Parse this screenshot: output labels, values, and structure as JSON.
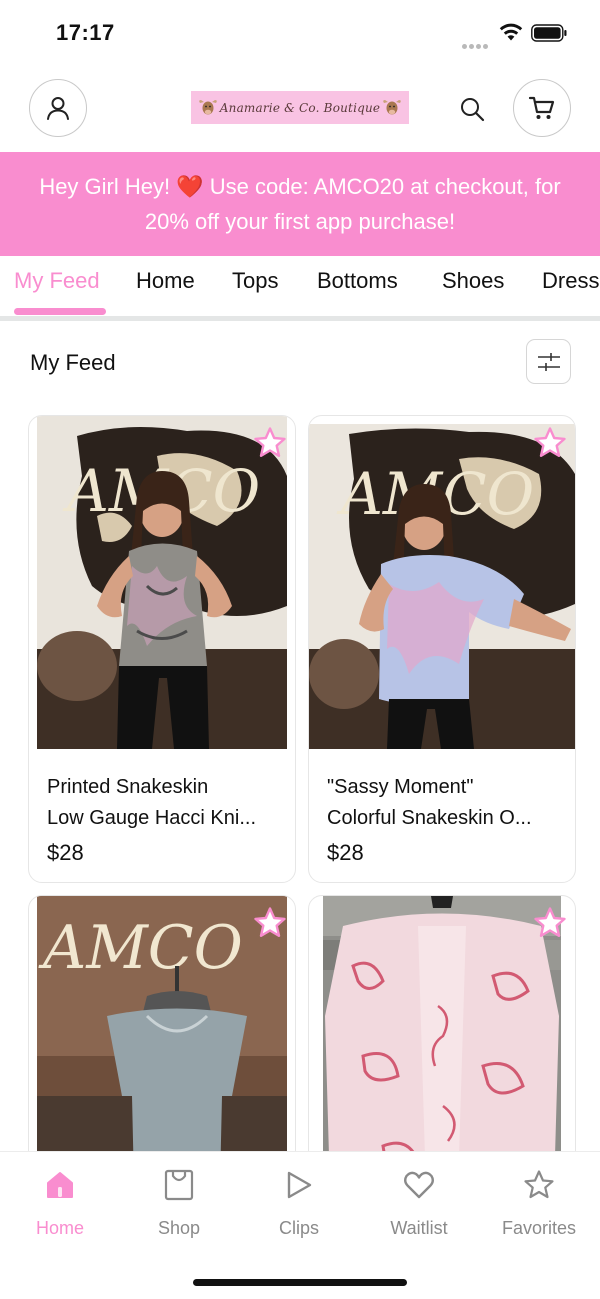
{
  "status_bar": {
    "time": "17:17"
  },
  "header": {
    "logo_text": "Anamarie & Co. Boutique"
  },
  "promo": {
    "line1": "Hey Girl Hey! ❤️ Use code: AMCO20 at checkout, for",
    "line2": "20% off your first app purchase!"
  },
  "tabs": [
    {
      "label": "My Feed"
    },
    {
      "label": "Home"
    },
    {
      "label": "Tops"
    },
    {
      "label": "Bottoms"
    },
    {
      "label": "Shoes"
    },
    {
      "label": "Dress"
    }
  ],
  "section": {
    "title": "My Feed"
  },
  "products": [
    {
      "name_line1": "Printed Snakeskin",
      "name_line2": "Low Gauge Hacci Kni...",
      "price": "$28"
    },
    {
      "name_line1": "\"Sassy Moment\"",
      "name_line2": "Colorful Snakeskin O...",
      "price": "$28"
    },
    {
      "name_line1": "",
      "name_line2": "",
      "price": ""
    },
    {
      "name_line1": "",
      "name_line2": "",
      "price": ""
    }
  ],
  "bottom_nav": [
    {
      "label": "Home",
      "icon": "home-icon",
      "active": true
    },
    {
      "label": "Shop",
      "icon": "shopping-bag-icon"
    },
    {
      "label": "Clips",
      "icon": "play-icon"
    },
    {
      "label": "Waitlist",
      "icon": "heart-icon"
    },
    {
      "label": "Favorites",
      "icon": "star-icon"
    }
  ],
  "colors": {
    "accent_pink": "#f98dcf",
    "logo_bg": "#f9c3e3",
    "text": "#111111",
    "inactive_nav": "#8a8a8a"
  }
}
